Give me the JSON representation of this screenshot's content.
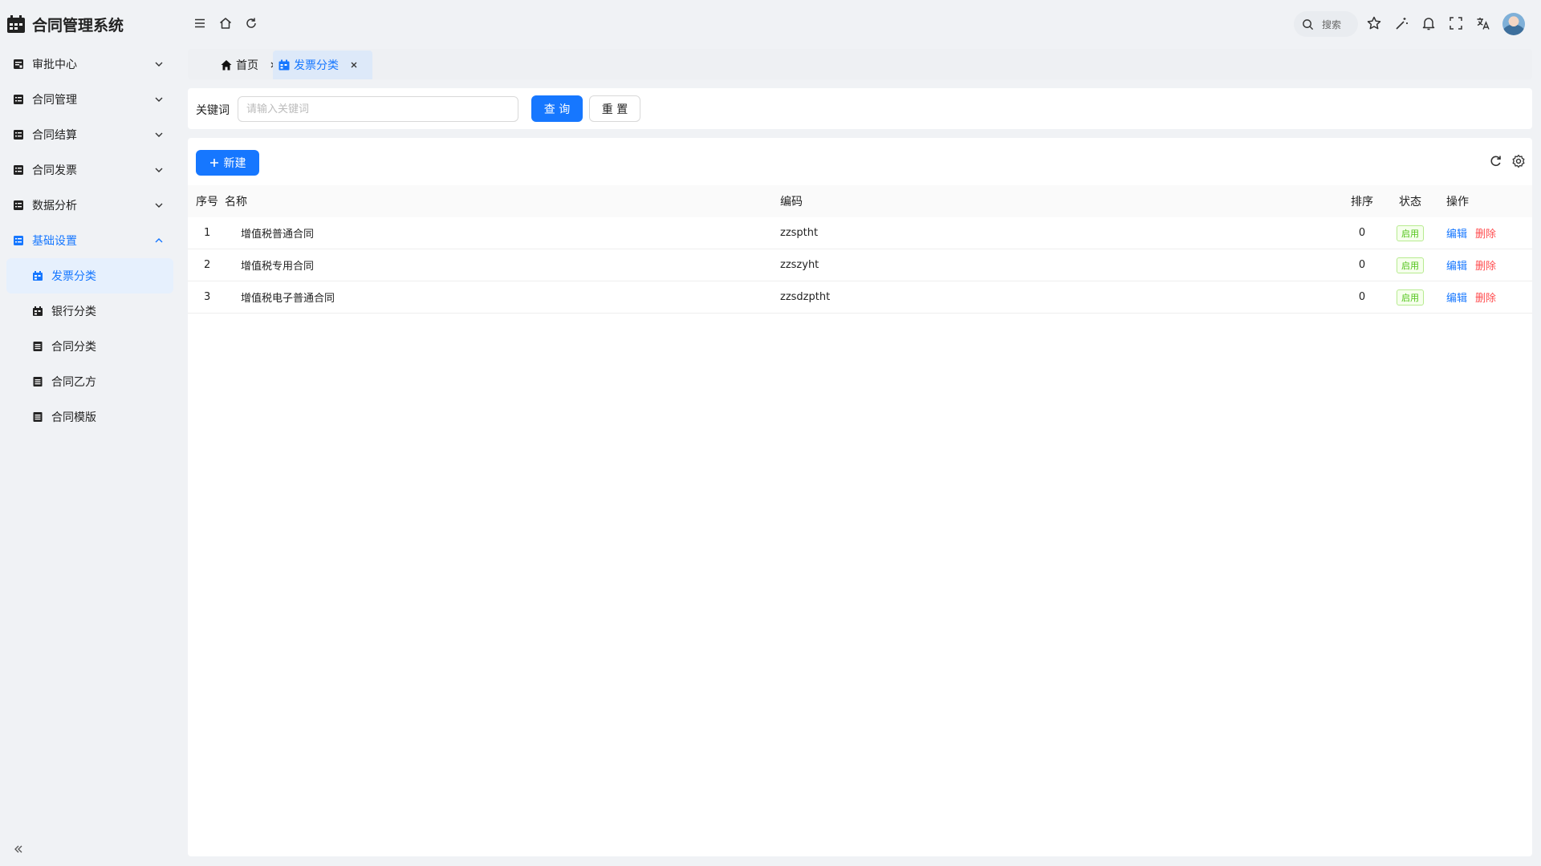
{
  "app": {
    "title": "合同管理系统"
  },
  "sidebar": {
    "menu": [
      {
        "label": "审批中心",
        "icon": "approval-icon",
        "expanded": false
      },
      {
        "label": "合同管理",
        "icon": "contract-icon",
        "expanded": false
      },
      {
        "label": "合同结算",
        "icon": "settlement-icon",
        "expanded": false
      },
      {
        "label": "合同发票",
        "icon": "invoice-icon",
        "expanded": false
      },
      {
        "label": "数据分析",
        "icon": "analysis-icon",
        "expanded": false
      },
      {
        "label": "基础设置",
        "icon": "settings-list-icon",
        "expanded": true
      }
    ],
    "submenu": [
      {
        "label": "发票分类",
        "active": true
      },
      {
        "label": "银行分类",
        "active": false
      },
      {
        "label": "合同分类",
        "active": false
      },
      {
        "label": "合同乙方",
        "active": false
      },
      {
        "label": "合同模版",
        "active": false
      }
    ]
  },
  "header": {
    "search_label": "搜索"
  },
  "tabs": [
    {
      "label": "首页",
      "icon": "home-icon"
    },
    {
      "label": "发票分类",
      "icon": "invoice-category-icon",
      "active": true
    }
  ],
  "search": {
    "keyword_label": "关键词",
    "keyword_placeholder": "请输入关键词",
    "keyword_value": "",
    "query_button": "查 询",
    "reset_button": "重 置"
  },
  "table": {
    "new_button": "新建",
    "columns": [
      "序号",
      "名称",
      "编码",
      "排序",
      "状态",
      "操作"
    ],
    "rows": [
      {
        "index": "1",
        "name": "增值税普通合同",
        "code": "zzsptht",
        "sort": "0",
        "status": "启用",
        "edit": "编辑",
        "delete": "删除"
      },
      {
        "index": "2",
        "name": "增值税专用合同",
        "code": "zzszyht",
        "sort": "0",
        "status": "启用",
        "edit": "编辑",
        "delete": "删除"
      },
      {
        "index": "3",
        "name": "增值税电子普通合同",
        "code": "zzsdzptht",
        "sort": "0",
        "status": "启用",
        "edit": "编辑",
        "delete": "删除"
      }
    ]
  },
  "colors": {
    "primary": "#1677ff",
    "danger": "#ff4d4f",
    "success": "#52c41a",
    "background": "#f0f2f5"
  }
}
